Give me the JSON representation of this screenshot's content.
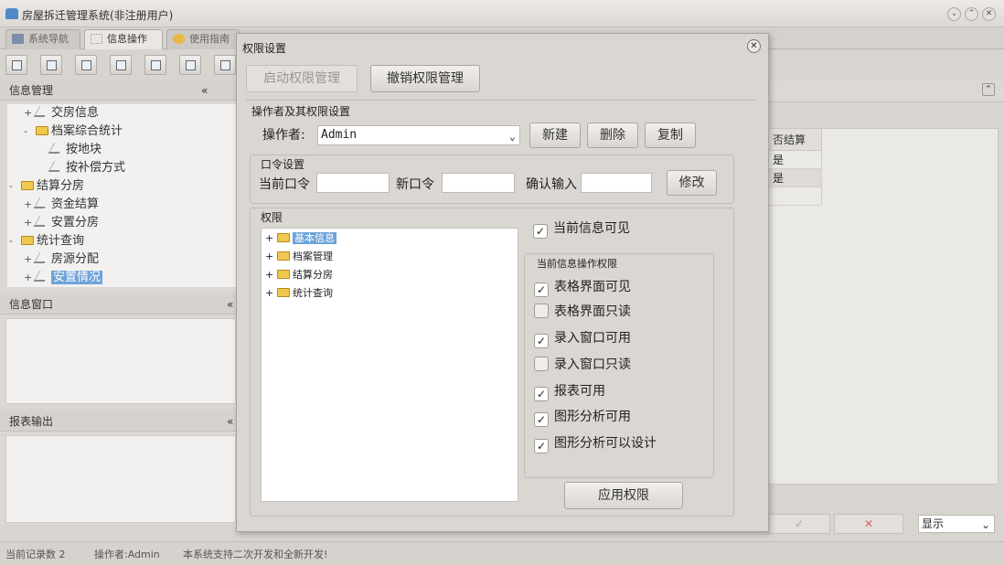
{
  "window": {
    "title": "房屋拆迁管理系统(非注册用户)"
  },
  "tabs": [
    {
      "label": "系统导航"
    },
    {
      "label": "信息操作"
    },
    {
      "label": "使用指南"
    }
  ],
  "left_panel": {
    "info_mgmt": "信息管理",
    "tree": [
      {
        "label": "交房信息",
        "expander": "+"
      },
      {
        "label": "档案综合统计",
        "expander": "-"
      },
      {
        "label": "按地块",
        "expander": ""
      },
      {
        "label": "按补偿方式",
        "expander": ""
      },
      {
        "label": "结算分房",
        "expander": "-"
      },
      {
        "label": "资金结算",
        "expander": "+"
      },
      {
        "label": "安置分房",
        "expander": "+"
      },
      {
        "label": "统计查询",
        "expander": "-"
      },
      {
        "label": "房源分配",
        "expander": "+"
      },
      {
        "label": "安置情况",
        "expander": "+"
      }
    ],
    "info_window": "信息窗口",
    "report_output": "报表输出"
  },
  "grid": {
    "header": "否结算",
    "rows": [
      "是",
      "是"
    ]
  },
  "bottom_right": {
    "display_select": "显示"
  },
  "status": {
    "record_count": "当前记录数 2",
    "operator": "操作者:Admin",
    "note": "本系统支持二次开发和全新开发!"
  },
  "dialog": {
    "title": "权限设置",
    "enable_btn": "启动权限管理",
    "revoke_btn": "撤销权限管理",
    "operator_group": "操作者及其权限设置",
    "operator_label": "操作者:",
    "operator_value": "Admin",
    "new_btn": "新建",
    "delete_btn": "删除",
    "copy_btn": "复制",
    "password_group": "口令设置",
    "current_pwd": "当前口令",
    "new_pwd": "新口令",
    "confirm_pwd": "确认输入",
    "modify_btn": "修改",
    "perm_group": "权限",
    "perm_tree": [
      "基本信息",
      "档案管理",
      "结算分房",
      "统计查询"
    ],
    "current_visible": "当前信息可见",
    "ops_group": "当前信息操作权限",
    "ops": [
      {
        "label": "表格界面可见",
        "checked": true
      },
      {
        "label": "表格界面只读",
        "checked": false
      },
      {
        "label": "录入窗口可用",
        "checked": true
      },
      {
        "label": "录入窗口只读",
        "checked": false
      },
      {
        "label": "报表可用",
        "checked": true
      },
      {
        "label": "图形分析可用",
        "checked": true
      },
      {
        "label": "图形分析可以设计",
        "checked": true
      }
    ],
    "apply_btn": "应用权限"
  }
}
